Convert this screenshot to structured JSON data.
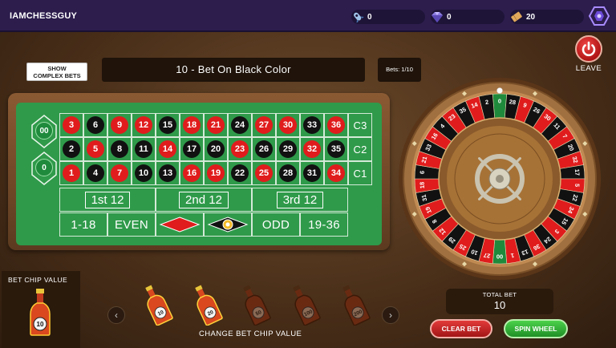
{
  "header": {
    "username": "IAMCHESSGUY",
    "balances": [
      {
        "icon": "rocket-icon",
        "value": "0"
      },
      {
        "icon": "diamond-gem-icon",
        "value": "0"
      },
      {
        "icon": "ticket-icon",
        "value": "20"
      }
    ]
  },
  "controls": {
    "complex_bets_line1": "SHOW",
    "complex_bets_line2": "COMPLEX BETS",
    "bet_title": "10 - Bet On Black Color",
    "bets_count": "Bets: 1/10",
    "leave_label": "LEAVE"
  },
  "table": {
    "zeros": [
      "00",
      "0"
    ],
    "rows": [
      [
        "3",
        "6",
        "9",
        "12",
        "15",
        "18",
        "21",
        "24",
        "27",
        "30",
        "33",
        "36"
      ],
      [
        "2",
        "5",
        "8",
        "11",
        "14",
        "17",
        "20",
        "23",
        "26",
        "29",
        "32",
        "35"
      ],
      [
        "1",
        "4",
        "7",
        "10",
        "13",
        "16",
        "19",
        "22",
        "25",
        "28",
        "31",
        "34"
      ]
    ],
    "columns": [
      "C3",
      "C2",
      "C1"
    ],
    "dozens": [
      "1st 12",
      "2nd 12",
      "3rd 12"
    ],
    "outside": [
      "1-18",
      "EVEN",
      "",
      "",
      "ODD",
      "19-36"
    ]
  },
  "colors": {
    "red": "#e01c1c",
    "black": "#111111",
    "green": "#2f9a4a"
  },
  "red_numbers": [
    1,
    3,
    5,
    7,
    9,
    12,
    14,
    16,
    18,
    19,
    21,
    23,
    25,
    27,
    30,
    32,
    34,
    36
  ],
  "wheel_numbers": [
    "0",
    "28",
    "9",
    "26",
    "30",
    "11",
    "7",
    "20",
    "32",
    "17",
    "5",
    "22",
    "34",
    "15",
    "3",
    "24",
    "36",
    "13",
    "1",
    "00",
    "27",
    "10",
    "25",
    "29",
    "12",
    "8",
    "19",
    "31",
    "18",
    "6",
    "21",
    "33",
    "16",
    "4",
    "23",
    "35",
    "14",
    "2"
  ],
  "bottom": {
    "bet_chip_value_label": "BET CHIP VALUE",
    "selected_chip": "10",
    "chips": [
      "10",
      "20",
      "50",
      "100",
      "200"
    ],
    "change_label": "CHANGE BET CHIP VALUE",
    "total_bet_label": "TOTAL BET",
    "total_bet_value": "10",
    "clear_bet": "CLEAR BET",
    "spin_wheel": "SPIN WHEEL"
  }
}
